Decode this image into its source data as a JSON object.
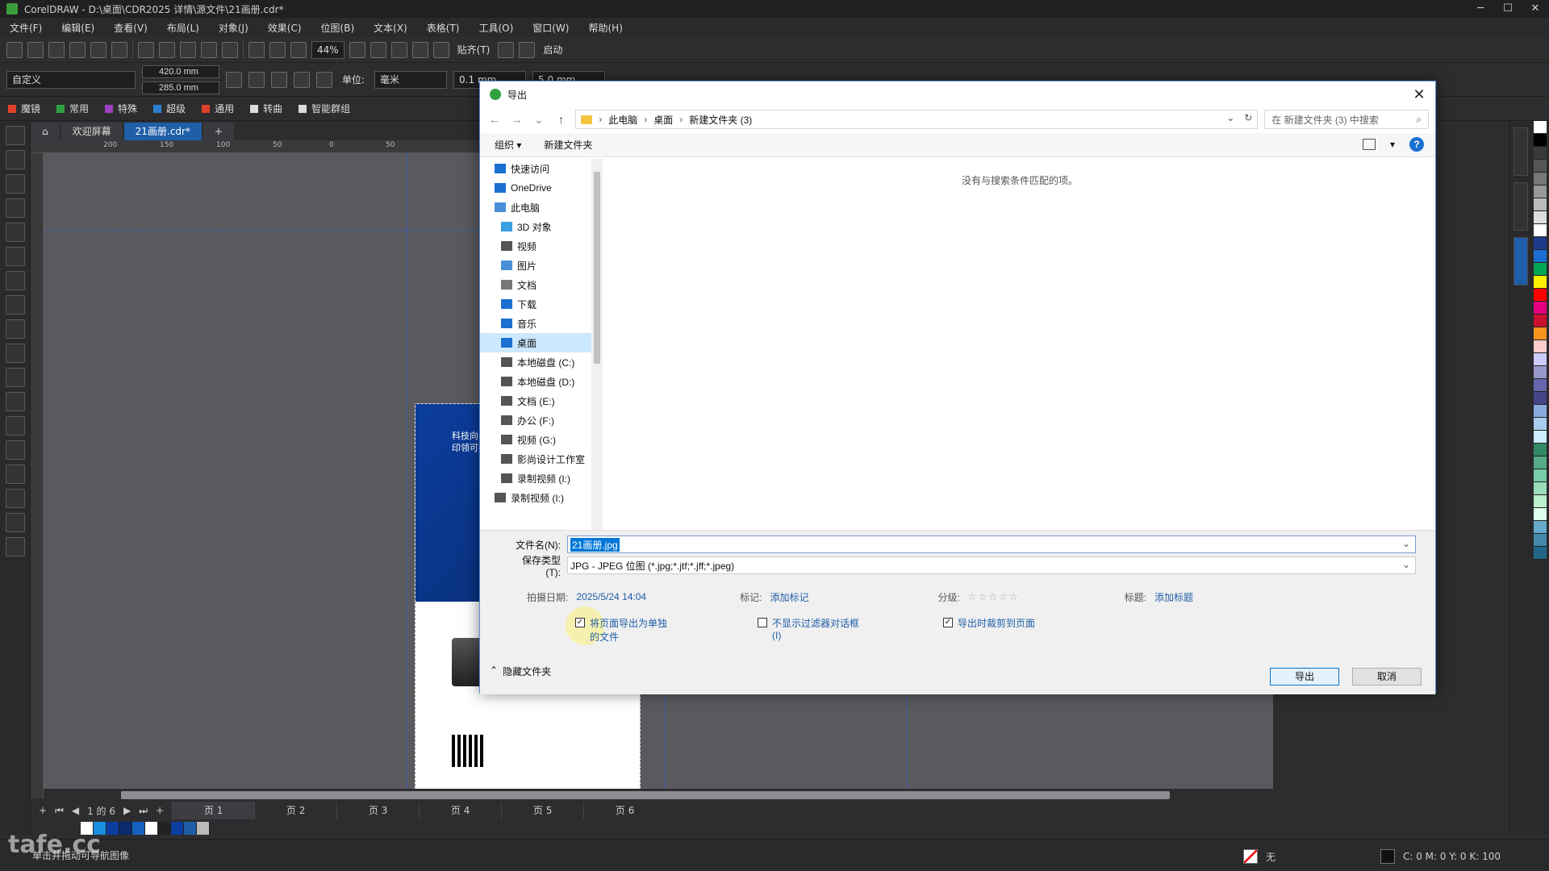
{
  "app": {
    "title": "CorelDRAW - D:\\桌面\\CDR2025 详情\\源文件\\21画册.cdr*"
  },
  "menu": [
    "文件(F)",
    "编辑(E)",
    "查看(V)",
    "布局(L)",
    "对象(J)",
    "效果(C)",
    "位图(B)",
    "文本(X)",
    "表格(T)",
    "工具(O)",
    "窗口(W)",
    "帮助(H)"
  ],
  "toolbar1": {
    "zoom": "44%",
    "snap_label": "贴齐(T)",
    "launch_label": "启动"
  },
  "toolbar2": {
    "preset": "自定义",
    "width": "420.0 mm",
    "height": "285.0 mm",
    "unit_label": "单位:",
    "unit_value": "毫米",
    "nudge": "0.1 mm",
    "duplicate": "5.0 mm"
  },
  "plugins": [
    "魔镜",
    "常用",
    "特殊",
    "超级",
    "通用",
    "转曲",
    "智能群组"
  ],
  "doc_tabs": [
    {
      "label": "欢迎屏幕"
    },
    {
      "label": "21画册.cdr*"
    }
  ],
  "ruler_ticks": [
    "200",
    "150",
    "100",
    "50",
    "0",
    "50"
  ],
  "page_content": {
    "line1": "科技向善",
    "line2": "印领可持续未来"
  },
  "page_nav": {
    "counter": "1 的 6",
    "pages": [
      "页 1",
      "页 2",
      "页 3",
      "页 4",
      "页 5",
      "页 6"
    ]
  },
  "status": {
    "hint": "单击并拖动可导航图像",
    "fill_none": "无",
    "cmyk": "C: 0 M: 0 Y: 0 K: 100"
  },
  "dialog": {
    "title": "导出",
    "breadcrumb": [
      "此电脑",
      "桌面",
      "新建文件夹 (3)"
    ],
    "search_placeholder": "在 新建文件夹 (3) 中搜索",
    "cmd_organize": "组织 ▾",
    "cmd_new_folder": "新建文件夹",
    "empty_message": "没有与搜索条件匹配的项。",
    "nav": [
      {
        "label": "快速访问",
        "indent": 0
      },
      {
        "label": "OneDrive",
        "indent": 0
      },
      {
        "label": "此电脑",
        "indent": 0
      },
      {
        "label": "3D 对象",
        "indent": 1
      },
      {
        "label": "视频",
        "indent": 1
      },
      {
        "label": "图片",
        "indent": 1
      },
      {
        "label": "文档",
        "indent": 1
      },
      {
        "label": "下载",
        "indent": 1
      },
      {
        "label": "音乐",
        "indent": 1
      },
      {
        "label": "桌面",
        "indent": 1,
        "selected": true
      },
      {
        "label": "本地磁盘 (C:)",
        "indent": 1
      },
      {
        "label": "本地磁盘 (D:)",
        "indent": 1
      },
      {
        "label": "文档 (E:)",
        "indent": 1
      },
      {
        "label": "办公 (F:)",
        "indent": 1
      },
      {
        "label": "视频 (G:)",
        "indent": 1
      },
      {
        "label": "影尚设计工作室",
        "indent": 1
      },
      {
        "label": "录制视频 (I:)",
        "indent": 1
      },
      {
        "label": "录制视频 (I:)",
        "indent": 0
      }
    ],
    "filename_label": "文件名(N):",
    "filename_value": "21画册.jpg",
    "savetype_label": "保存类型(T):",
    "savetype_value": "JPG - JPEG 位图 (*.jpg;*.jtf;*.jff;*.jpeg)",
    "meta": {
      "date_label": "拍摄日期:",
      "date_value": "2025/5/24 14:04",
      "tags_label": "标记:",
      "tags_value": "添加标记",
      "rating_label": "分级:",
      "rating_value": "☆☆☆☆☆",
      "title_label": "标题:",
      "title_value": "添加标题"
    },
    "checkboxes": [
      {
        "label": "将页面导出为单独的文件",
        "checked": true
      },
      {
        "label": "不显示过滤器对话框(I)",
        "checked": false
      },
      {
        "label": "导出时裁剪到页面",
        "checked": true
      }
    ],
    "hide_folders": "隐藏文件夹",
    "export_btn": "导出",
    "cancel_btn": "取消"
  },
  "colors": {
    "accent": "#1f5ea8",
    "page_blue": "#0b3e9e",
    "selection": "#0078d7"
  },
  "watermark": "tafe.cc"
}
